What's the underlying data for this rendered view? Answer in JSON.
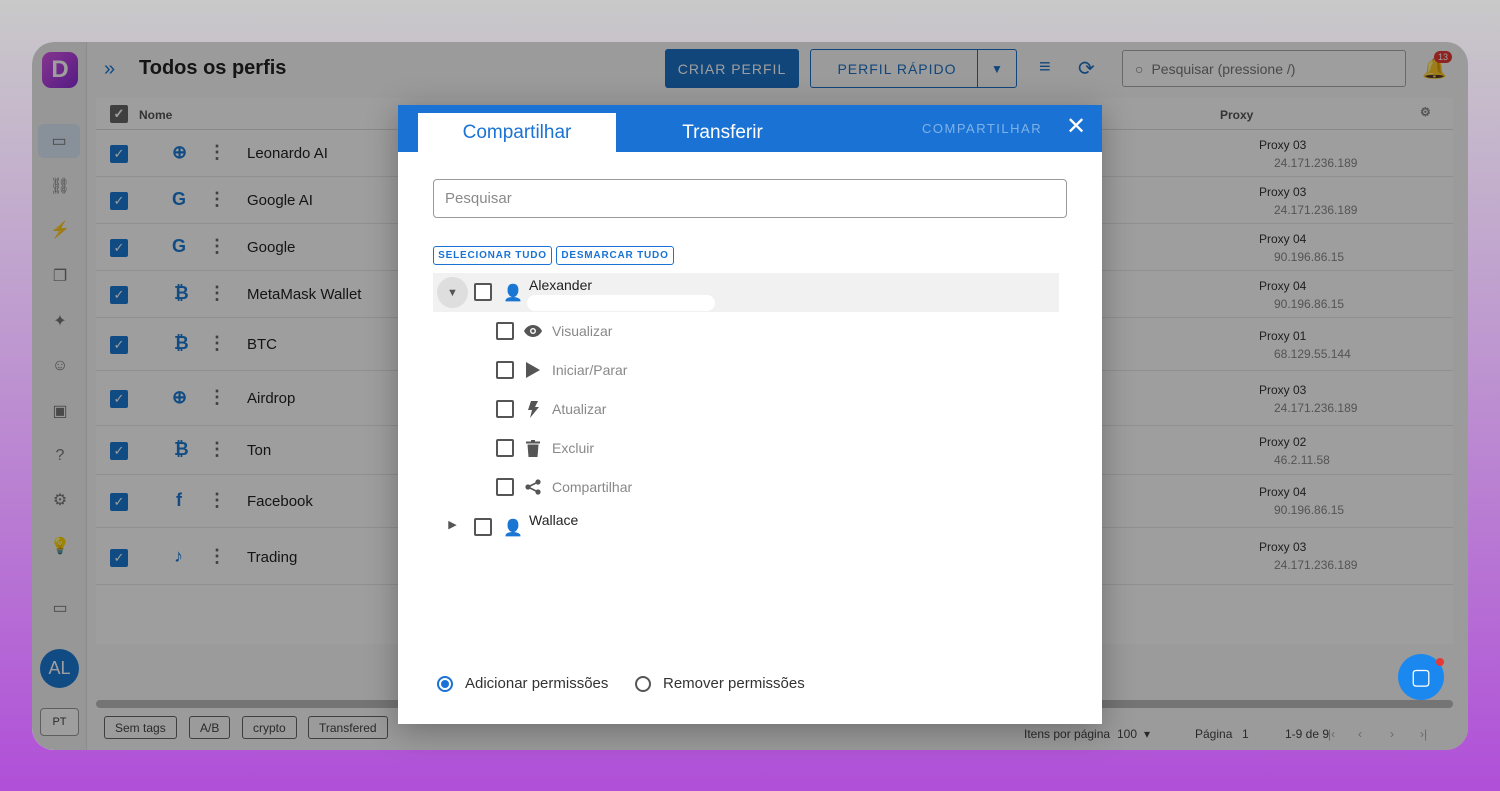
{
  "app": {
    "logo": "D"
  },
  "header": {
    "title": "Todos os perfis",
    "create_button": "CRIAR PERFIL",
    "quick_button": "PERFIL RÁPIDO",
    "search_placeholder": "Pesquisar (pressione /)",
    "notification_count": "13"
  },
  "table": {
    "columns": {
      "name": "Nome",
      "proxy": "Proxy"
    },
    "rows": [
      {
        "name": "Leonardo AI",
        "proxy": "Proxy 03",
        "ip": "24.171.236.189"
      },
      {
        "name": "Google AI",
        "proxy": "Proxy 03",
        "ip": "24.171.236.189"
      },
      {
        "name": "Google",
        "proxy": "Proxy 04",
        "ip": "90.196.86.15"
      },
      {
        "name": "MetaMask Wallet",
        "proxy": "Proxy 04",
        "ip": "90.196.86.15"
      },
      {
        "name": "BTC",
        "proxy": "Proxy 01",
        "ip": "68.129.55.144"
      },
      {
        "name": "Airdrop",
        "proxy": "Proxy 03",
        "ip": "24.171.236.189"
      },
      {
        "name": "Ton",
        "proxy": "Proxy 02",
        "ip": "46.2.11.58"
      },
      {
        "name": "Facebook",
        "proxy": "Proxy 04",
        "ip": "90.196.86.15"
      },
      {
        "name": "Trading",
        "proxy": "Proxy 03",
        "ip": "24.171.236.189"
      }
    ]
  },
  "footer": {
    "tags": [
      "Sem tags",
      "A/B",
      "crypto",
      "Transfered"
    ],
    "items_per_page_label": "Itens por página",
    "items_per_page": "100",
    "page_label": "Página",
    "page": "1",
    "range": "1-9 de 9"
  },
  "sidebar": {
    "avatar": "AL",
    "language": "PT"
  },
  "modal": {
    "tab_share": "Compartilhar",
    "tab_transfer": "Transferir",
    "action": "COMPARTILHAR",
    "search_placeholder": "Pesquisar",
    "select_all": "SELECIONAR TUDO",
    "deselect_all": "DESMARCAR TUDO",
    "users": [
      {
        "name": "Alexander",
        "expanded": true
      },
      {
        "name": "Wallace",
        "expanded": false
      }
    ],
    "permissions": [
      {
        "label": "Visualizar",
        "icon": "eye-icon"
      },
      {
        "label": "Iniciar/Parar",
        "icon": "play-icon"
      },
      {
        "label": "Atualizar",
        "icon": "bolt-icon"
      },
      {
        "label": "Excluir",
        "icon": "trash-icon"
      },
      {
        "label": "Compartilhar",
        "icon": "share-icon"
      }
    ],
    "add_permissions": "Adicionar permissões",
    "remove_permissions": "Remover permissões",
    "selected_mode": "add"
  },
  "colors": {
    "accent": "#1a73d4",
    "brand": "#b04fd8"
  }
}
